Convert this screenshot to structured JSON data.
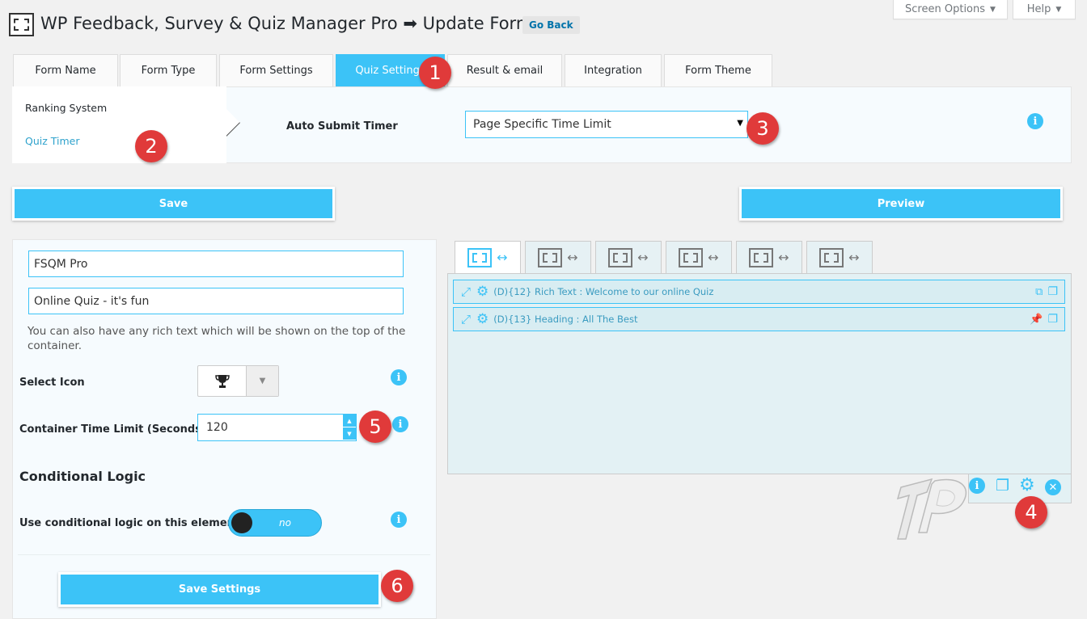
{
  "header": {
    "title": "WP Feedback, Survey & Quiz Manager Pro",
    "arrow": "➡",
    "subtitle": "Update Form",
    "go_back": "Go Back",
    "screen_options": "Screen Options",
    "help": "Help"
  },
  "tabs": [
    {
      "label": "Form Name"
    },
    {
      "label": "Form Type"
    },
    {
      "label": "Form Settings"
    },
    {
      "label": "Quiz Settings"
    },
    {
      "label": "Result & email"
    },
    {
      "label": "Integration"
    },
    {
      "label": "Form Theme"
    }
  ],
  "subnav": {
    "items": [
      {
        "label": "Ranking System"
      },
      {
        "label": "Quiz Timer"
      }
    ]
  },
  "timer": {
    "label": "Auto Submit Timer",
    "value": "Page Specific Time Limit"
  },
  "actions": {
    "save": "Save",
    "preview": "Preview",
    "save_settings": "Save Settings"
  },
  "container": {
    "title_value": "FSQM Pro",
    "subtitle_value": "Online Quiz - it's fun",
    "help_text": "You can also have any rich text which will be shown on the top of the container.",
    "select_icon_label": "Select Icon",
    "time_limit_label": "Container Time Limit (Seconds)",
    "time_limit_value": "120",
    "conditional_heading": "Conditional Logic",
    "conditional_label": "Use conditional logic on this element",
    "conditional_state": "no"
  },
  "builder": {
    "elements": [
      {
        "text": "(D){12} Rich Text : Welcome to our online Quiz"
      },
      {
        "text": "(D){13} Heading : All The Best"
      }
    ]
  },
  "callouts": [
    "1",
    "2",
    "3",
    "4",
    "5",
    "6"
  ],
  "colors": {
    "accent": "#3cc3f7",
    "callout": "#e03a3a",
    "link": "#0073aa"
  }
}
